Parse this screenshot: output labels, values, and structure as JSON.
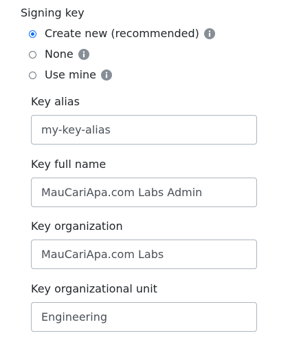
{
  "signing_key": {
    "label": "Signing key",
    "options": [
      {
        "label": "Create new (recommended)",
        "checked": true,
        "info_icon": "info-circle-icon"
      },
      {
        "label": "None",
        "checked": false,
        "info_icon": "info-circle-icon"
      },
      {
        "label": "Use mine",
        "checked": false,
        "info_icon": "info-circle-icon"
      }
    ]
  },
  "fields": {
    "alias": {
      "label": "Key alias",
      "value": "my-key-alias"
    },
    "full_name": {
      "label": "Key full name",
      "value": "MauCariApa.com Labs Admin"
    },
    "organization": {
      "label": "Key organization",
      "value": "MauCariApa.com Labs"
    },
    "org_unit": {
      "label": "Key organizational unit",
      "value": "Engineering"
    }
  },
  "colors": {
    "accent": "#0d6efd",
    "info_icon": "#868e96",
    "input_border": "#adb5bd",
    "text": "#212529"
  }
}
